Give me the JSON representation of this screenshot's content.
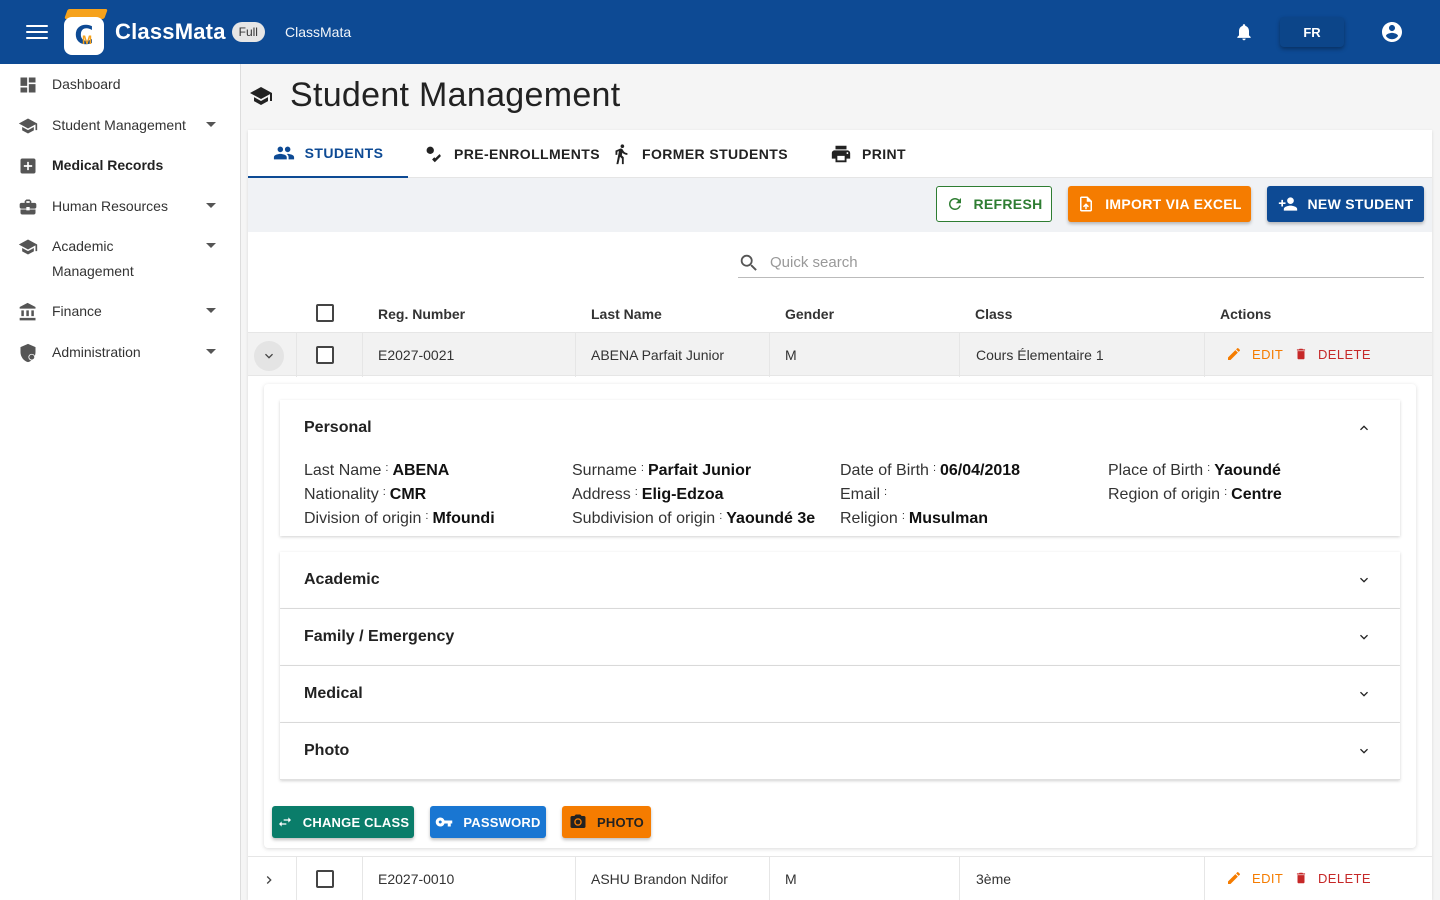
{
  "header": {
    "brand": "ClassMata",
    "plan_badge": "Full",
    "app_subtitle": "ClassMata",
    "language": "FR",
    "colors": {
      "primary": "#0d4a94",
      "accent": "#f6a21c"
    },
    "icons": [
      "menu-icon",
      "logo-icon",
      "bell-icon",
      "account-icon"
    ]
  },
  "sidebar": {
    "items": [
      {
        "label": "Dashboard",
        "icon": "dashboard-icon",
        "has_children": false
      },
      {
        "label": "Student Management",
        "icon": "school-icon",
        "has_children": true
      },
      {
        "label": "Medical Records",
        "icon": "medical-icon",
        "has_children": false
      },
      {
        "label": "Human Resources",
        "icon": "briefcase-icon",
        "has_children": true
      },
      {
        "label_line1": "Academic",
        "label_line2": "Management",
        "icon": "school-icon",
        "has_children": true
      },
      {
        "label": "Finance",
        "icon": "bank-icon",
        "has_children": true
      },
      {
        "label": "Administration",
        "icon": "shield-icon",
        "has_children": true
      }
    ]
  },
  "page": {
    "title": "Student Management",
    "title_icon": "school-icon"
  },
  "tabs": [
    {
      "label": "STUDENTS",
      "icon": "people-icon",
      "active": true
    },
    {
      "label": "PRE-ENROLLMENTS",
      "icon": "person-check-icon",
      "active": false
    },
    {
      "label": "FORMER STUDENTS",
      "icon": "walking-person-icon",
      "active": false
    },
    {
      "label": "PRINT",
      "icon": "printer-icon",
      "active": false
    }
  ],
  "toolbar": {
    "refresh_label": "REFRESH",
    "import_label": "IMPORT VIA EXCEL",
    "new_label": "NEW STUDENT"
  },
  "search": {
    "placeholder": "Quick search",
    "value": ""
  },
  "table": {
    "columns": [
      "Reg. Number",
      "Last Name",
      "Gender",
      "Class",
      "Actions"
    ],
    "edit_label": "EDIT",
    "delete_label": "DELETE",
    "rows": [
      {
        "reg": "E2027-0021",
        "name": "ABENA Parfait Junior",
        "gender": "M",
        "class": "Cours Élementaire 1",
        "expanded": true
      },
      {
        "reg": "E2027-0010",
        "name": "ASHU Brandon Ndifor",
        "gender": "M",
        "class": "3ème",
        "expanded": false
      }
    ]
  },
  "detail": {
    "personal": {
      "title": "Personal",
      "fields": [
        {
          "k": "Last Name",
          "v": "ABENA"
        },
        {
          "k": "Surname",
          "v": "Parfait Junior"
        },
        {
          "k": "Date of Birth",
          "v": "06/04/2018"
        },
        {
          "k": "Place of Birth",
          "v": "Yaoundé"
        },
        {
          "k": "Nationality",
          "v": "CMR"
        },
        {
          "k": "Address",
          "v": "Elig-Edzoa"
        },
        {
          "k": "Email",
          "v": ""
        },
        {
          "k": "Region of origin",
          "v": "Centre"
        },
        {
          "k": "Division of origin",
          "v": "Mfoundi"
        },
        {
          "k": "Subdivision of origin",
          "v": "Yaoundé 3e"
        },
        {
          "k": "Religion",
          "v": "Musulman"
        }
      ]
    },
    "sections": [
      "Academic",
      "Family / Emergency",
      "Medical",
      "Photo"
    ],
    "buttons": {
      "change_class": "CHANGE CLASS",
      "password": "PASSWORD",
      "photo": "PHOTO"
    }
  }
}
